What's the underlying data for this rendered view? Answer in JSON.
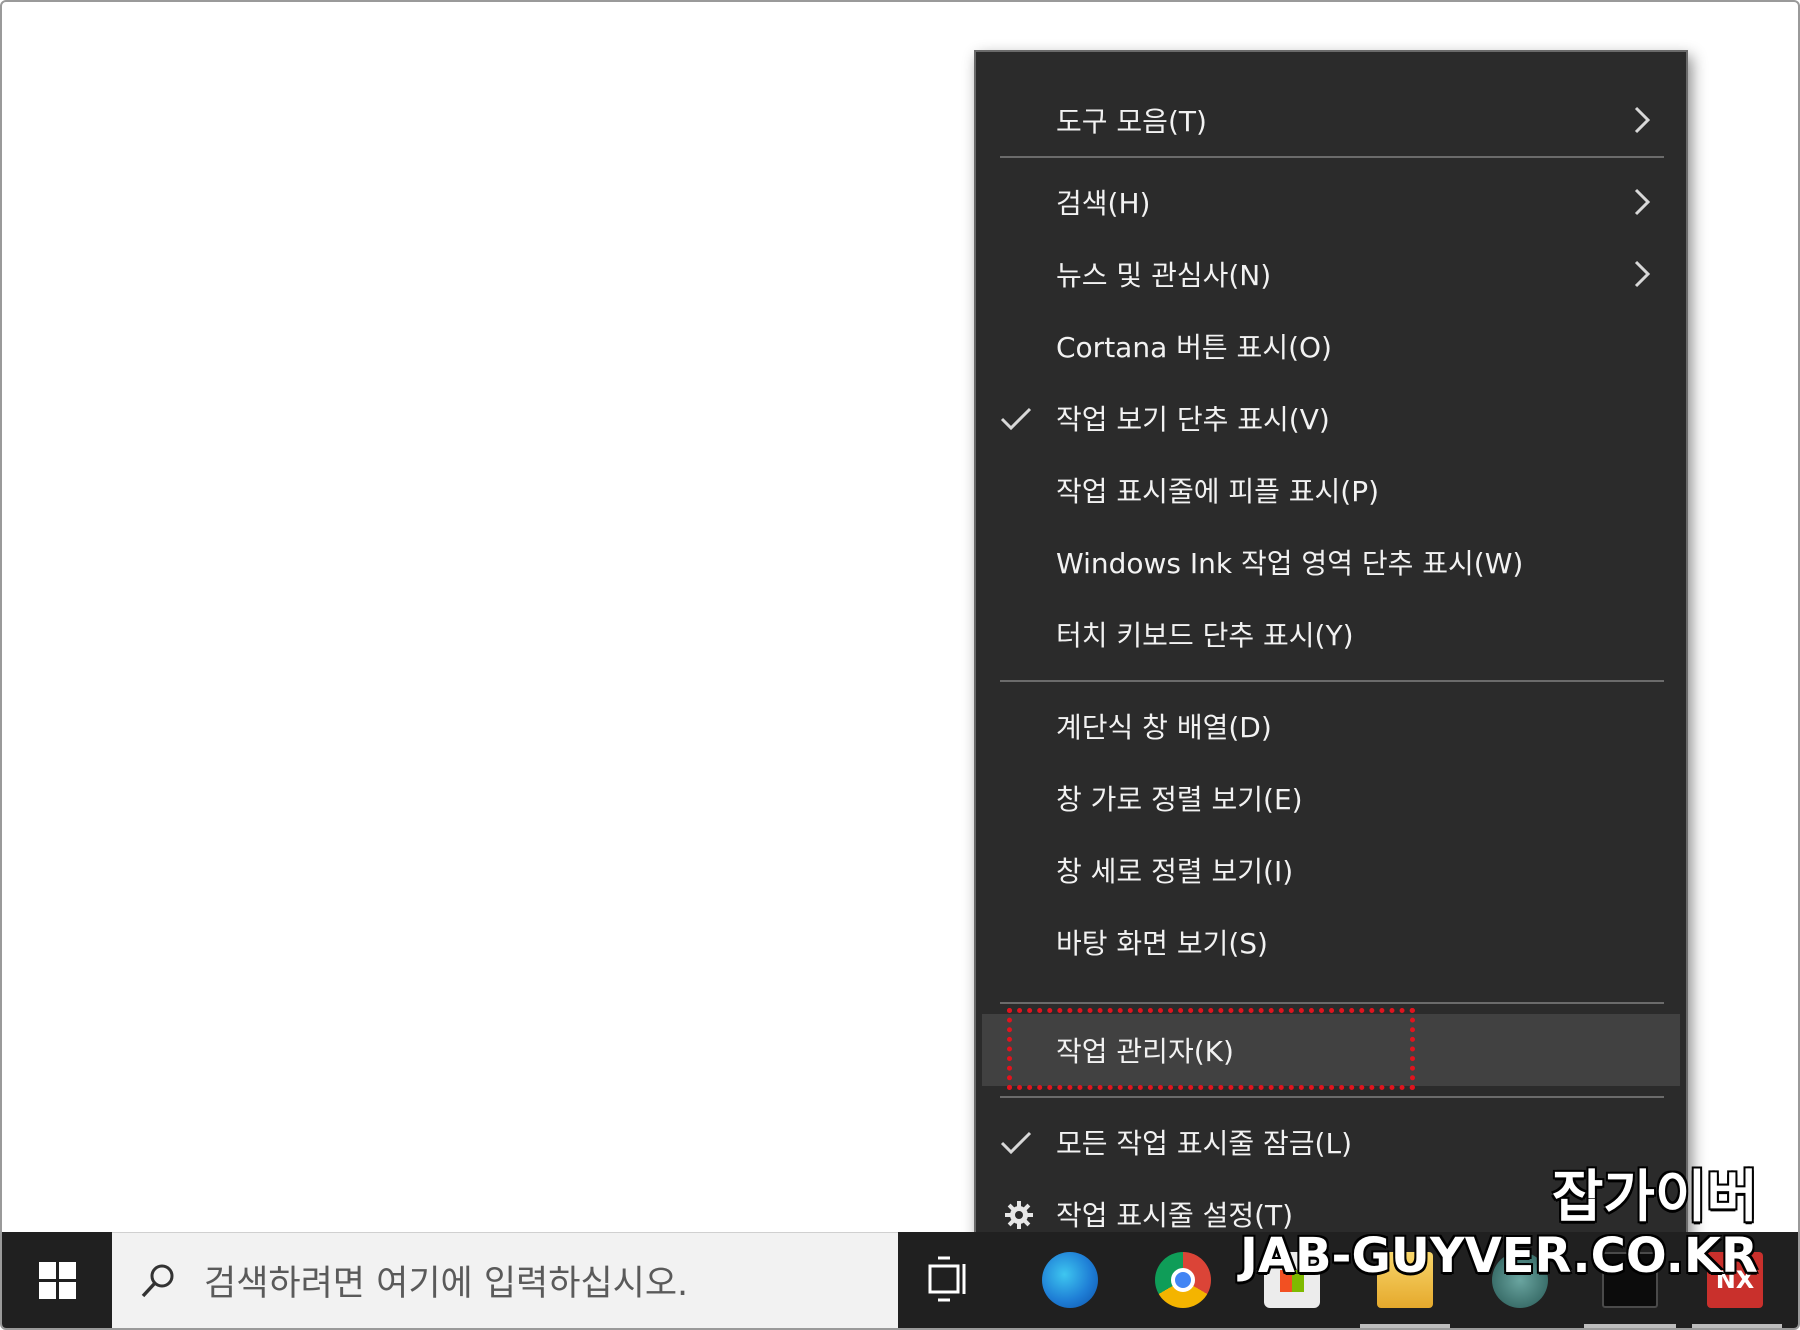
{
  "taskbar": {
    "search_placeholder": "검색하려면 여기에 입력하십시오.",
    "icons": [
      "windows-logo-icon",
      "search-icon",
      "task-view-icon",
      "edge-icon",
      "chrome-icon",
      "store-icon",
      "file-explorer-icon",
      "people-icon",
      "terminal-icon",
      "nx-app-icon"
    ],
    "nx_label": "NX"
  },
  "context_menu": {
    "items": [
      {
        "label": "도구 모음(T)",
        "submenu": true
      },
      {
        "label": "검색(H)",
        "submenu": true
      },
      {
        "label": "뉴스 및 관심사(N)",
        "submenu": true
      },
      {
        "label": "Cortana 버튼 표시(O)"
      },
      {
        "label": "작업 보기 단추 표시(V)",
        "checked": true
      },
      {
        "label": "작업 표시줄에 피플 표시(P)"
      },
      {
        "label": "Windows Ink 작업 영역 단추 표시(W)"
      },
      {
        "label": "터치 키보드 단추 표시(Y)"
      },
      {
        "label": "계단식 창 배열(D)"
      },
      {
        "label": "창 가로 정렬 보기(E)"
      },
      {
        "label": "창 세로 정렬 보기(I)"
      },
      {
        "label": "바탕 화면 보기(S)"
      },
      {
        "label": "작업 관리자(K)",
        "highlighted": true
      },
      {
        "label": "모든 작업 표시줄 잠금(L)",
        "checked": true
      },
      {
        "label": "작업 표시줄 설정(T)",
        "icon": "gear-icon"
      }
    ]
  },
  "colors": {
    "menu_bg": "#2b2b2b",
    "menu_hover": "#414141",
    "menu_text": "#f2f2f2",
    "highlight_border": "#e0141e",
    "taskbar_bg": "#202020"
  },
  "watermark": {
    "name": "잡가이버",
    "site": "JAB-GUYVER.CO.KR"
  }
}
